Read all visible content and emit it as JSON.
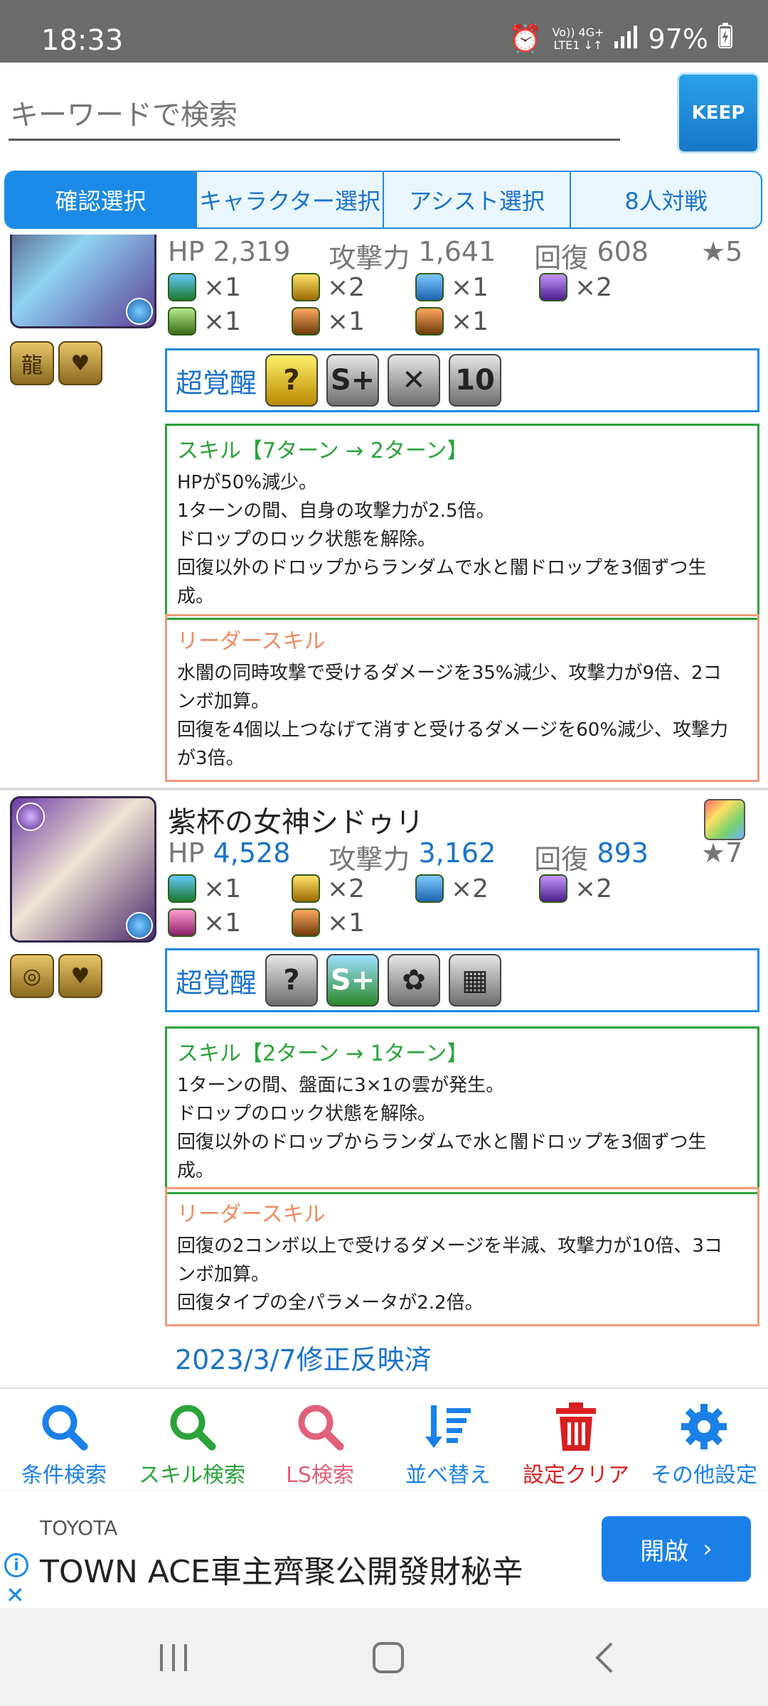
{
  "status_bar": {
    "time": "18:33",
    "network_top": "Vo)) 4G+",
    "network_bottom": "LTE1 ↓↑",
    "battery": "97%"
  },
  "search": {
    "placeholder": "キーワードで検索",
    "keep_label": "KEEP"
  },
  "tabs": [
    {
      "label": "確認選択",
      "active": true
    },
    {
      "label": "キャラクター選択",
      "active": false
    },
    {
      "label": "アシスト選択",
      "active": false
    },
    {
      "label": "8人対戦",
      "active": false
    }
  ],
  "cards": [
    {
      "hp_label": "HP",
      "hp": "2,319",
      "atk_label": "攻撃力",
      "atk": "1,641",
      "rcv_label": "回復",
      "rcv": "608",
      "rarity": "★5",
      "latents": [
        "×1",
        "×2",
        "×1",
        "×2",
        "×1",
        "×1",
        "×1"
      ],
      "super_awakening_label": "超覚醒",
      "skill_title": "スキル【7ターン → 2ターン】",
      "skill_lines": [
        "HPが50%減少。",
        "1ターンの間、自身の攻撃力が2.5倍。",
        "ドロップのロック状態を解除。",
        "回復以外のドロップからランダムで水と闇ドロップを3個ずつ生",
        "成。"
      ],
      "ls_title": "リーダースキル",
      "ls_lines": [
        "水闇の同時攻撃で受けるダメージを35%減少、攻撃力が9倍、2コ",
        "ンボ加算。",
        "回復を4個以上つなげて消すと受けるダメージを60%減少、攻撃力",
        "が3倍。"
      ]
    },
    {
      "name": "紫杯の女神シドゥリ",
      "hp_label": "HP",
      "hp": "4,528",
      "atk_label": "攻撃力",
      "atk": "3,162",
      "rcv_label": "回復",
      "rcv": "893",
      "rarity": "★7",
      "latents": [
        "×1",
        "×2",
        "×2",
        "×2",
        "×1",
        "×1"
      ],
      "super_awakening_label": "超覚醒",
      "skill_title": "スキル【2ターン → 1ターン】",
      "skill_lines": [
        "1ターンの間、盤面に3×1の雲が発生。",
        "ドロップのロック状態を解除。",
        "回復以外のドロップからランダムで水と闇ドロップを3個ずつ生",
        "成。"
      ],
      "ls_title": "リーダースキル",
      "ls_lines": [
        "回復の2コンボ以上で受けるダメージを半減、攻撃力が10倍、3コ",
        "ンボ加算。",
        "回復タイプの全パラメータが2.2倍。"
      ],
      "note": "2023/3/7修正反映済"
    }
  ],
  "toolbar": [
    {
      "label": "条件検索",
      "color": "#1a80e8",
      "icon": "search-icon"
    },
    {
      "label": "スキル検索",
      "color": "#2aa33a",
      "icon": "search-icon"
    },
    {
      "label": "LS検索",
      "color": "#e0607a",
      "icon": "search-icon"
    },
    {
      "label": "並べ替え",
      "color": "#1a80e8",
      "icon": "sort-icon"
    },
    {
      "label": "設定クリア",
      "color": "#d82020",
      "icon": "trash-icon"
    },
    {
      "label": "その他設定",
      "color": "#1a80e8",
      "icon": "gear-icon"
    }
  ],
  "ad": {
    "brand": "TOYOTA",
    "headline": "TOWN ACE車主齊聚公開發財秘辛",
    "button": "開啟"
  }
}
